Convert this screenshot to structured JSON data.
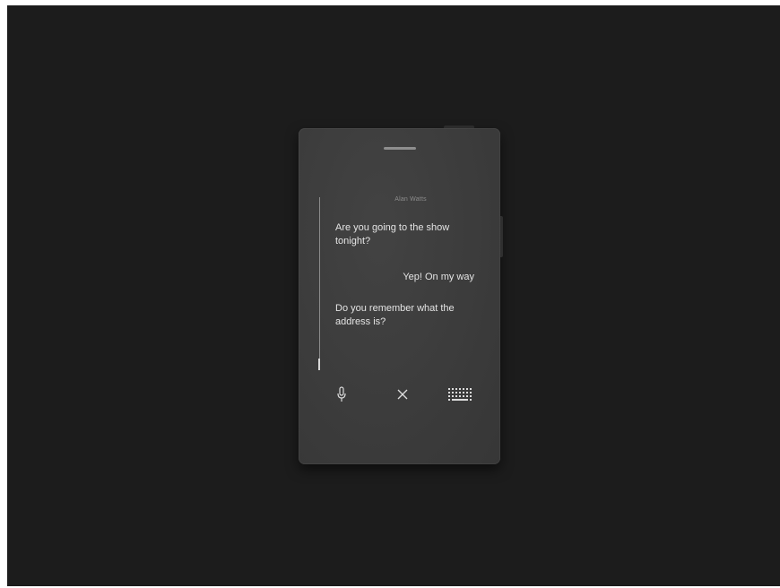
{
  "conversation": {
    "contact_name": "Alan Watts",
    "messages": [
      {
        "direction": "incoming",
        "text": "Are you going to the show tonight?"
      },
      {
        "direction": "outgoing",
        "text": "Yep! On my way"
      },
      {
        "direction": "incoming",
        "text": "Do you remember what the address is?"
      }
    ]
  },
  "controls": {
    "mic_icon": "microphone-icon",
    "close_icon": "close-icon",
    "keyboard_icon": "keyboard-icon"
  },
  "colors": {
    "background": "#1c1c1c",
    "device_body": "#3b3b3b",
    "text_primary": "#e4e4e4",
    "text_secondary": "#8c8c8c"
  }
}
